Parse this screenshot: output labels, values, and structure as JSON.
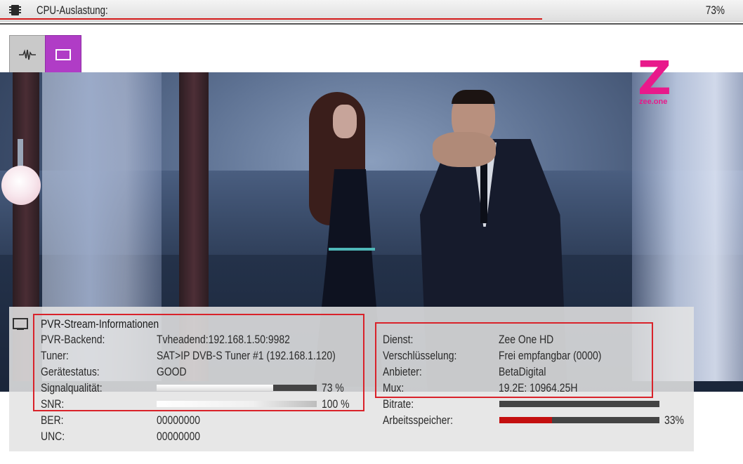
{
  "cpu": {
    "label": "CPU-Auslastung:",
    "value": "73%",
    "fraction": 0.73,
    "bar_color": "#d41a1a",
    "icon": "cpu-chip-icon"
  },
  "mode_buttons": [
    {
      "icon": "signal-waveform-icon",
      "active": false
    },
    {
      "icon": "video-rectangle-icon",
      "active": true,
      "color": "#b03cc6"
    }
  ],
  "channel_logo": {
    "glyph": "Z",
    "text": "zee.one",
    "color": "#e8198b"
  },
  "pvr": {
    "title": "PVR-Stream-Informationen",
    "backend_label": "PVR-Backend:",
    "backend_value": "Tvheadend:192.168.1.50:9982",
    "tuner_label": "Tuner:",
    "tuner_value": "SAT>IP DVB-S Tuner #1 (192.168.1.120)",
    "status_label": "Gerätestatus:",
    "status_value": "GOOD",
    "signal_label": "Signalqualität:",
    "signal_value": "73 %",
    "signal_fraction": 0.73,
    "snr_label": "SNR:",
    "snr_value": "100 %",
    "snr_fraction": 1.0,
    "ber_label": "BER:",
    "ber_value": "00000000",
    "unc_label": "UNC:",
    "unc_value": "00000000"
  },
  "service": {
    "service_label": "Dienst:",
    "service_value": "Zee One HD",
    "encryption_label": "Verschlüsselung:",
    "encryption_value": "Frei empfangbar (0000)",
    "provider_label": "Anbieter:",
    "provider_value": "BetaDigital",
    "mux_label": "Mux:",
    "mux_value": "19.2E: 10964.25H",
    "bitrate_label": "Bitrate:",
    "bitrate_fraction": 0.0,
    "memory_label": "Arbeitsspeicher:",
    "memory_value": "33%",
    "memory_fraction": 0.33
  },
  "colors": {
    "highlight": "#d9222a",
    "bar_dark": "#444444",
    "bar_red": "#c40f0f"
  }
}
